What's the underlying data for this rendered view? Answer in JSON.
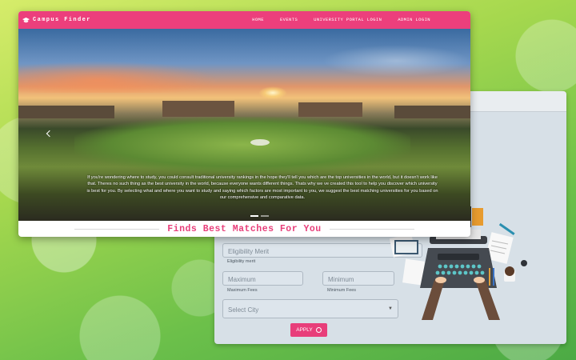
{
  "app": {
    "brand": "Campus Finder"
  },
  "nav": {
    "items": [
      {
        "label": "HOME"
      },
      {
        "label": "EVENTS"
      },
      {
        "label": "UNIVERSITY PORTAL LOGIN"
      },
      {
        "label": "ADMIN LOGIN"
      }
    ]
  },
  "hero": {
    "text": "If you're wondering where to study, you could consult traditional university rankings in the hope they'll tell you which are the top universities in the world, but it doesn't work like that. Theres no such thing as the best university in the world, because everyone wants different things. Thats why we ve created this tool to help you discover which university is best for you. By selecting what and where you want to study and saying which factors are most important to you, we suggest the best matching universities for you based on our comprehensive and comparative data."
  },
  "section": {
    "title": "Finds Best Matches For You"
  },
  "form": {
    "eligibility": {
      "placeholder": "Eligibility Merit",
      "hint": "Eligibility merit"
    },
    "max_fees": {
      "placeholder": "Maximum",
      "hint": "Maximum Fees"
    },
    "min_fees": {
      "placeholder": "Minimum",
      "hint": "Minimum Fees"
    },
    "city": {
      "selected": "Select City"
    },
    "apply_label": "APPLY"
  },
  "colors": {
    "accent": "#ec3f7c",
    "form_bg": "#d7e0e7",
    "background_green": "#6cc04a"
  },
  "icons": [
    "graduation-cap-icon",
    "chevron-left-icon",
    "caret-down-icon",
    "refresh-icon"
  ]
}
